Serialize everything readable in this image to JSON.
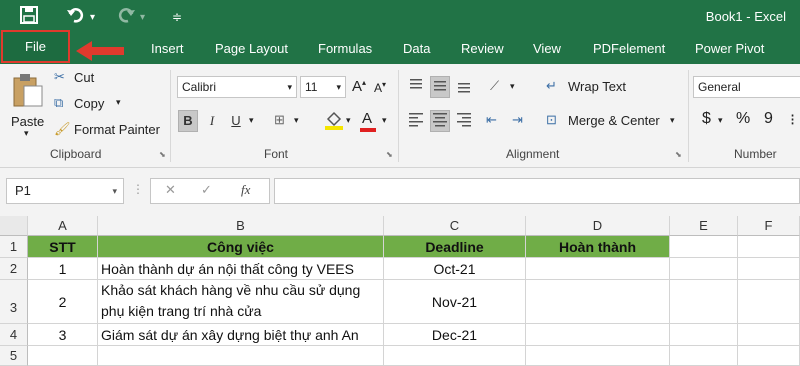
{
  "window": {
    "title": "Book1 - Excel"
  },
  "tabs": [
    "File",
    "Insert",
    "Page Layout",
    "Formulas",
    "Data",
    "Review",
    "View",
    "PDFelement",
    "Power Pivot"
  ],
  "clipboard": {
    "paste": "Paste",
    "cut": "Cut",
    "copy": "Copy",
    "format_painter": "Format Painter",
    "label": "Clipboard"
  },
  "font": {
    "name": "Calibri",
    "size": "11",
    "bold": "B",
    "italic": "I",
    "underline": "U",
    "grow": "A",
    "shrink": "A",
    "color_a": "A",
    "label": "Font"
  },
  "alignment": {
    "wrap_text": "Wrap Text",
    "merge_center": "Merge & Center",
    "label": "Alignment"
  },
  "number": {
    "format": "General",
    "currency": "$",
    "percent": "%",
    "comma": "9",
    "label": "Number"
  },
  "formula_bar": {
    "name_box": "P1",
    "fx": "fx"
  },
  "sheet": {
    "columns": [
      "A",
      "B",
      "C",
      "D",
      "E",
      "F"
    ],
    "rows": [
      "1",
      "2",
      "3",
      "4",
      "5"
    ],
    "header": [
      "STT",
      "Công việc",
      "Deadline",
      "Hoàn thành"
    ],
    "data": [
      {
        "stt": "1",
        "task": "Hoàn thành dự án nội thất công ty VEES",
        "deadline": "Oct-21"
      },
      {
        "stt": "2",
        "task_l1": "Khảo sát khách hàng về nhu cầu sử dụng",
        "task_l2": "phụ kiện trang trí nhà cửa",
        "deadline": "Nov-21"
      },
      {
        "stt": "3",
        "task": "Giám sát dự án xây dựng biệt thự anh An",
        "deadline": "Dec-21"
      }
    ]
  },
  "colors": {
    "brand": "#217346",
    "header_fill": "#70ad47",
    "highlight": "#e03a2d"
  }
}
